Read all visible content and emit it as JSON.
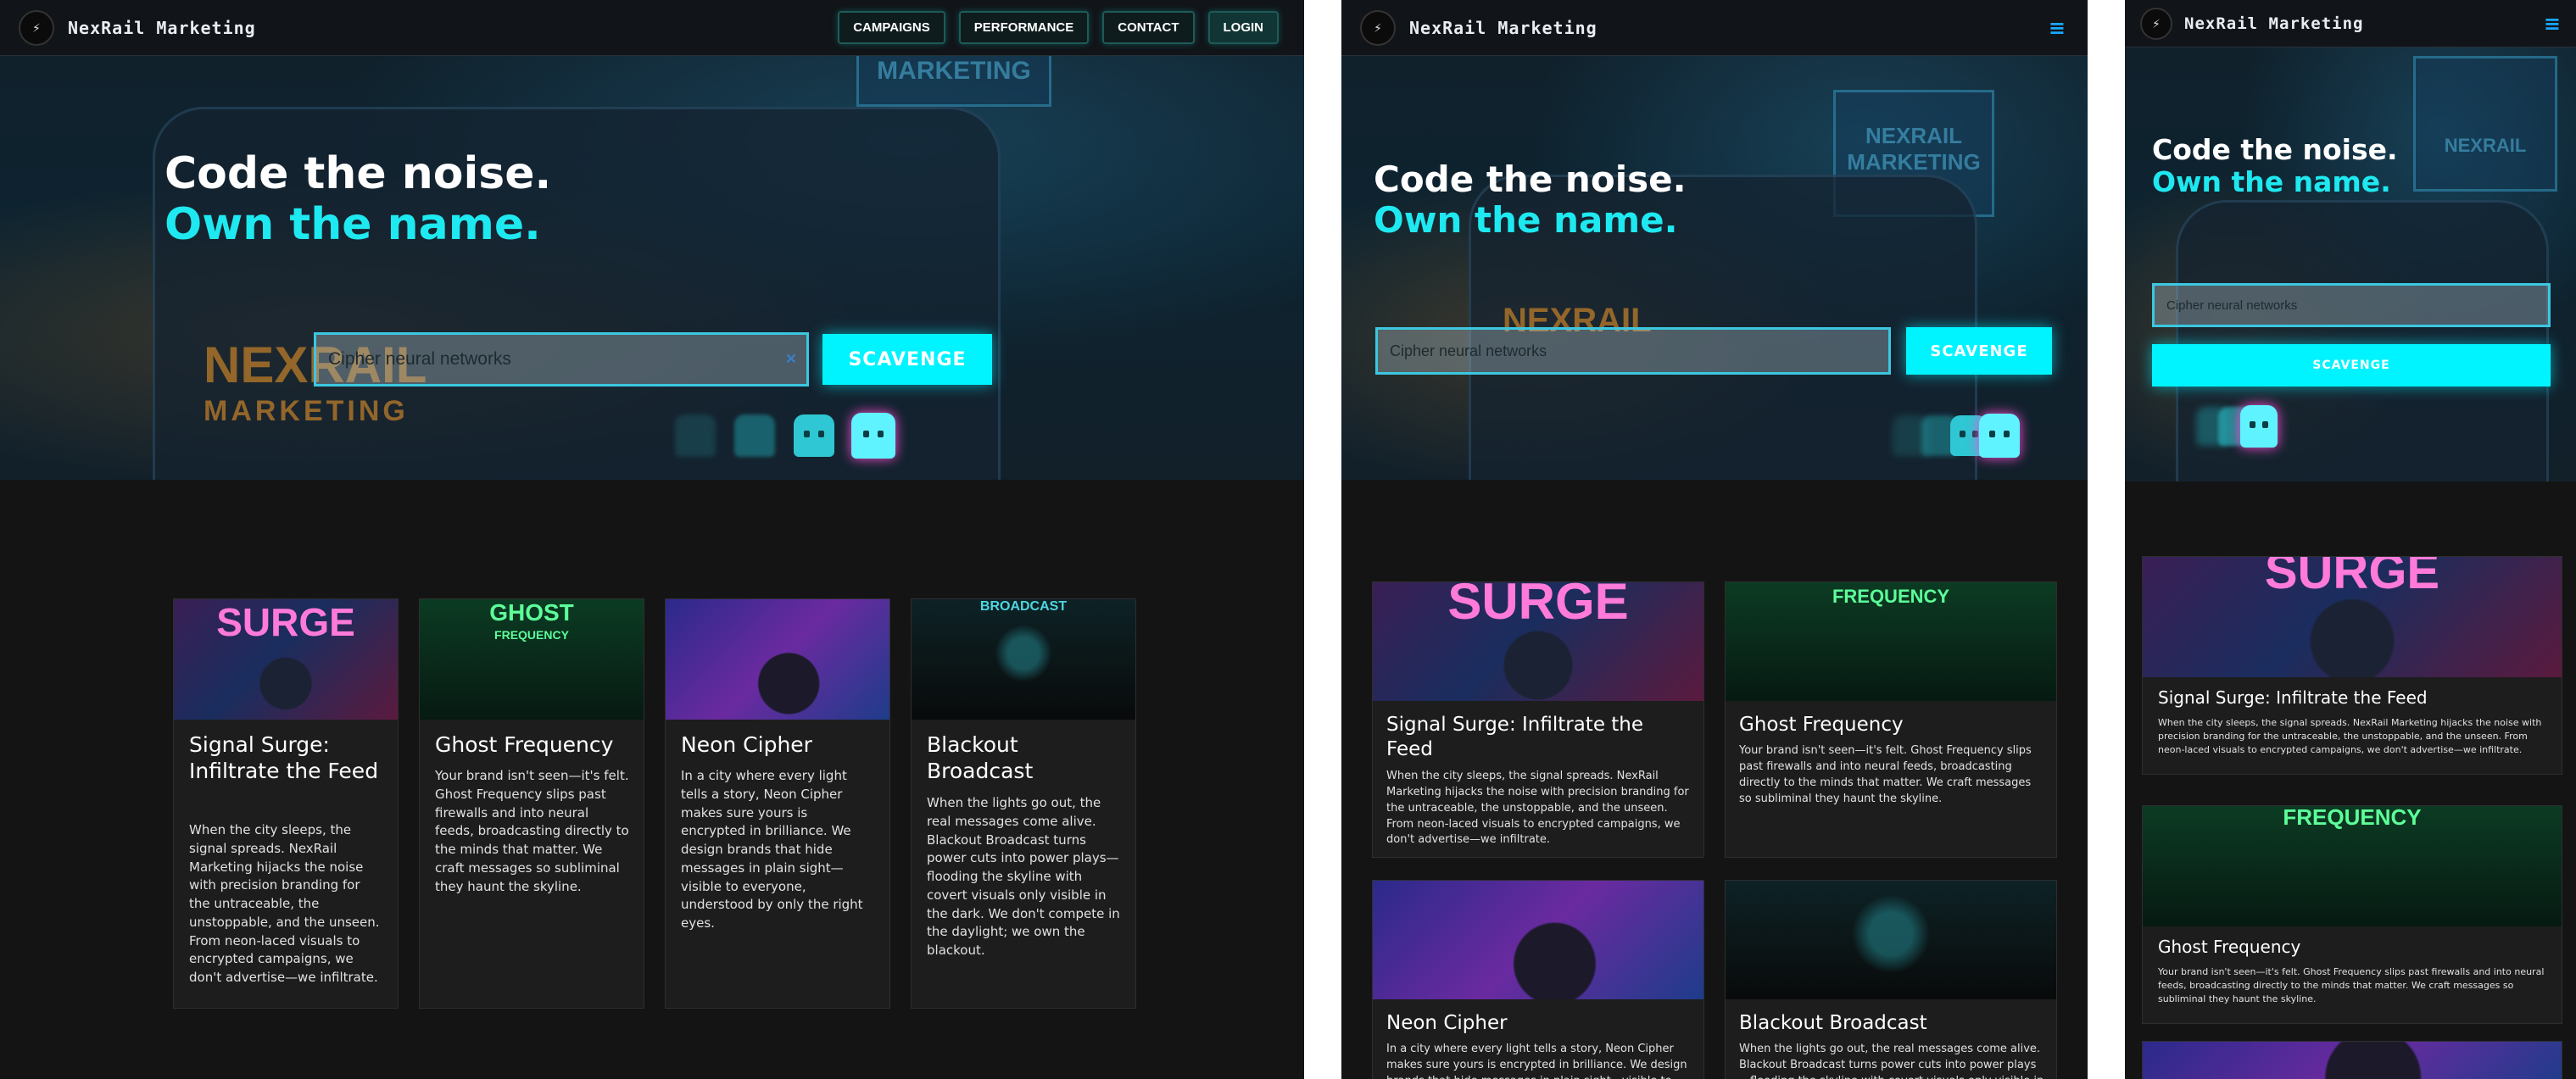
{
  "brand": {
    "name": "NexRail Marketing",
    "logo_text": "NEXRAIL MARKETING"
  },
  "nav": {
    "links": [
      "CAMPAIGNS",
      "PERFORMANCE",
      "CONTACT",
      "LOGIN"
    ],
    "menu_icon": "hamburger-menu-icon"
  },
  "hero": {
    "headline_line1": "Code the noise.",
    "headline_line2": "Own the name.",
    "search_value": "Cipher neural networks",
    "search_clear": "×",
    "button_label": "SCAVENGE",
    "background_sign_text": "NEXRAIL MARKETING",
    "background_sign_word1": "NEXRAIL",
    "background_sign_word2": "MARKETING"
  },
  "cards": [
    {
      "title": "Signal Surge: Infiltrate the Feed",
      "image_text": "SURGE",
      "body": "When the city sleeps, the signal spreads. NexRail Marketing hijacks the noise with precision branding for the untraceable, the unstoppable, and the unseen. From neon-laced visuals to encrypted campaigns, we don't advertise—we infiltrate."
    },
    {
      "title": "Ghost Frequency",
      "image_text": "GHOST",
      "image_subtext": "FREQUENCY",
      "body": "Your brand isn't seen—it's felt. Ghost Frequency slips past firewalls and into neural feeds, broadcasting directly to the minds that matter. We craft messages so subliminal they haunt the skyline."
    },
    {
      "title": "Neon Cipher",
      "body": "In a city where every light tells a story, Neon Cipher makes sure yours is encrypted in brilliance. We design brands that hide messages in plain sight—visible to everyone, understood by only the right eyes."
    },
    {
      "title": "Blackout Broadcast",
      "image_text": "BROADCAST",
      "body": "When the lights go out, the real messages come alive. Blackout Broadcast turns power cuts into power plays—flooding the skyline with covert visuals only visible in the dark. We don't compete in the daylight; we own the blackout."
    }
  ],
  "colors": {
    "accent": "#00f4ff",
    "headline_accent": "#1fe9f0",
    "page_bg": "#141414",
    "card_bg": "#1d1d1d",
    "menu_icon": "#18a7ff"
  }
}
